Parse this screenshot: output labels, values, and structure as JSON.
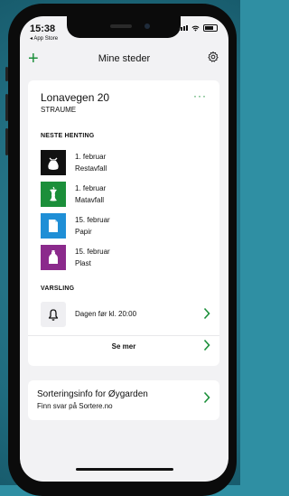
{
  "status_bar": {
    "time": "15:38",
    "back_app": "◂ App Store"
  },
  "nav": {
    "title": "Mine steder",
    "add_icon": "plus-icon",
    "settings_icon": "gear-icon"
  },
  "location": {
    "address": "Lonavegen 20",
    "city": "STRAUME",
    "more_icon": "ellipsis-icon"
  },
  "next_pickup": {
    "label": "NESTE HENTING",
    "items": [
      {
        "date": "1. februar",
        "type": "Restavfall",
        "color": "#111111",
        "icon": "trash-bag-icon"
      },
      {
        "date": "1. februar",
        "type": "Matavfall",
        "color": "#1b8f3a",
        "icon": "apple-core-icon"
      },
      {
        "date": "15. februar",
        "type": "Papir",
        "color": "#1f8fd6",
        "icon": "paper-icon"
      },
      {
        "date": "15. februar",
        "type": "Plast",
        "color": "#8b2a8c",
        "icon": "bottle-icon"
      }
    ]
  },
  "notification": {
    "label": "VARSLING",
    "text": "Dagen før kl. 20:00",
    "icon": "bell-icon"
  },
  "see_more": "Se mer",
  "sorting": {
    "title": "Sorteringsinfo for Øygarden",
    "subtitle": "Finn svar på Sortere.no"
  },
  "colors": {
    "accent": "#1b8f3a"
  }
}
